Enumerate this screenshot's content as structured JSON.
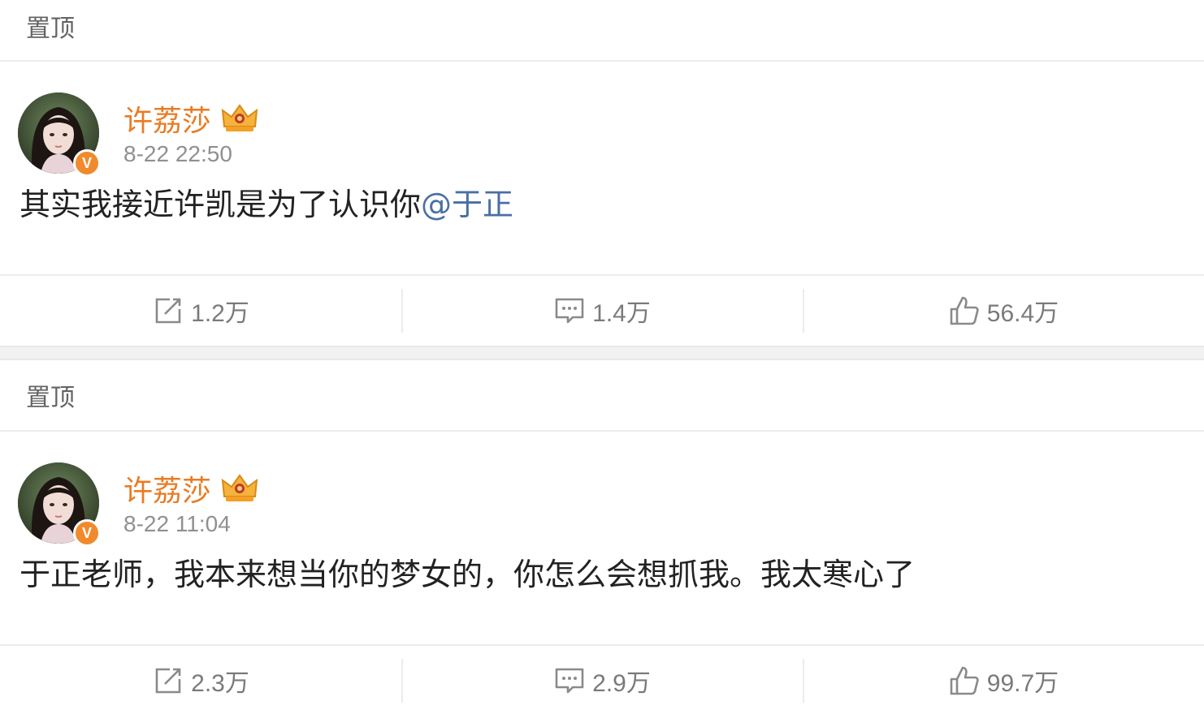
{
  "posts": [
    {
      "pin_label": "置顶",
      "author": "许荔莎",
      "verified_badge": "V",
      "timestamp": "8-22 22:50",
      "text": "其实我接近许凯是为了认识你",
      "mention": "@于正",
      "actions": {
        "repost": "1.2万",
        "comment": "1.4万",
        "like": "56.4万"
      }
    },
    {
      "pin_label": "置顶",
      "author": "许荔莎",
      "verified_badge": "V",
      "timestamp": "8-22 11:04",
      "text": "于正老师，我本来想当你的梦女的，你怎么会想抓我。我太寒心了",
      "mention": "",
      "actions": {
        "repost": "2.3万",
        "comment": "2.9万",
        "like": "99.7万"
      }
    }
  ],
  "icons": {
    "repost": "repost-icon",
    "comment": "comment-icon",
    "like": "thumbs-up-icon",
    "crown": "crown-badge-icon"
  },
  "colors": {
    "author_name": "#e97b24",
    "mention": "#4a6fa5",
    "verified_badge": "#f08a2c",
    "muted_text": "#909090"
  }
}
